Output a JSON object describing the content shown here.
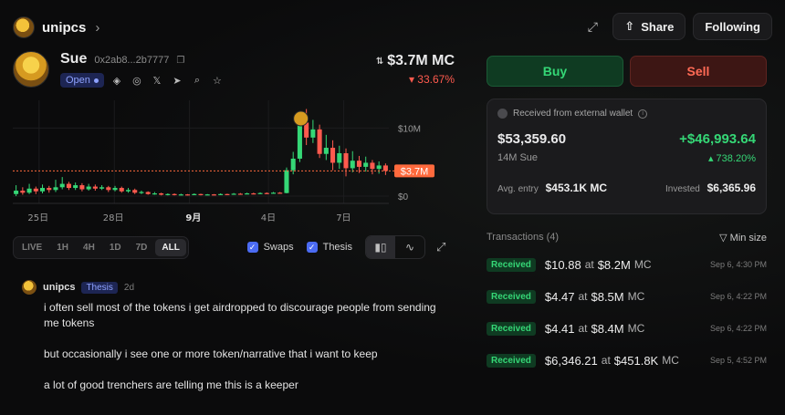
{
  "header": {
    "username": "unipcs",
    "share_label": "Share",
    "following_label": "Following"
  },
  "token": {
    "name": "Sue",
    "address": "0x2ab8...2b7777",
    "status": "Open",
    "market_cap": "$3.7M MC",
    "change": "▾ 33.67%"
  },
  "chart": {
    "price_tag": "$3.7M",
    "y_labels": [
      "$10M",
      "$0"
    ],
    "x_labels": [
      "25日",
      "28日",
      "9月",
      "4日",
      "7日"
    ]
  },
  "chart_data": {
    "type": "candlestick",
    "title": "",
    "xlabel": "",
    "ylabel": "",
    "ylim": [
      0,
      13
    ],
    "y_unit": "$M market cap",
    "x_ticks": [
      "25日",
      "28日",
      "9月",
      "4日",
      "7日"
    ],
    "current_value": 3.7,
    "current_label": "$3.7M",
    "candles": [
      {
        "o": 0.3,
        "c": 0.8,
        "h": 1.6,
        "l": 0.0
      },
      {
        "o": 0.8,
        "c": 0.5,
        "h": 1.3,
        "l": 0.2
      },
      {
        "o": 0.5,
        "c": 1.1,
        "h": 1.8,
        "l": 0.3
      },
      {
        "o": 1.1,
        "c": 0.7,
        "h": 1.4,
        "l": 0.3
      },
      {
        "o": 0.7,
        "c": 1.2,
        "h": 1.7,
        "l": 0.4
      },
      {
        "o": 1.2,
        "c": 0.9,
        "h": 1.5,
        "l": 0.5
      },
      {
        "o": 0.9,
        "c": 1.3,
        "h": 2.4,
        "l": 0.6
      },
      {
        "o": 1.3,
        "c": 1.8,
        "h": 2.8,
        "l": 1.0
      },
      {
        "o": 1.8,
        "c": 1.2,
        "h": 2.1,
        "l": 0.9
      },
      {
        "o": 1.2,
        "c": 1.6,
        "h": 2.0,
        "l": 0.9
      },
      {
        "o": 1.6,
        "c": 1.0,
        "h": 1.9,
        "l": 0.7
      },
      {
        "o": 1.0,
        "c": 1.4,
        "h": 1.8,
        "l": 0.8
      },
      {
        "o": 1.4,
        "c": 1.1,
        "h": 1.7,
        "l": 0.8
      },
      {
        "o": 1.1,
        "c": 1.3,
        "h": 1.6,
        "l": 0.9
      },
      {
        "o": 1.3,
        "c": 0.9,
        "h": 1.5,
        "l": 0.6
      },
      {
        "o": 0.9,
        "c": 1.2,
        "h": 1.5,
        "l": 0.7
      },
      {
        "o": 1.2,
        "c": 0.7,
        "h": 1.4,
        "l": 0.5
      },
      {
        "o": 0.7,
        "c": 0.9,
        "h": 1.2,
        "l": 0.5
      },
      {
        "o": 0.9,
        "c": 0.5,
        "h": 1.1,
        "l": 0.3
      },
      {
        "o": 0.5,
        "c": 0.6,
        "h": 0.8,
        "l": 0.3
      },
      {
        "o": 0.6,
        "c": 0.3,
        "h": 0.7,
        "l": 0.2
      },
      {
        "o": 0.3,
        "c": 0.4,
        "h": 0.6,
        "l": 0.2
      },
      {
        "o": 0.4,
        "c": 0.2,
        "h": 0.5,
        "l": 0.1
      },
      {
        "o": 0.2,
        "c": 0.3,
        "h": 0.4,
        "l": 0.1
      },
      {
        "o": 0.3,
        "c": 0.2,
        "h": 0.4,
        "l": 0.1
      },
      {
        "o": 0.2,
        "c": 0.25,
        "h": 0.35,
        "l": 0.1
      },
      {
        "o": 0.25,
        "c": 0.2,
        "h": 0.3,
        "l": 0.1
      },
      {
        "o": 0.2,
        "c": 0.3,
        "h": 0.4,
        "l": 0.15
      },
      {
        "o": 0.3,
        "c": 0.2,
        "h": 0.35,
        "l": 0.1
      },
      {
        "o": 0.2,
        "c": 0.25,
        "h": 0.3,
        "l": 0.15
      },
      {
        "o": 0.25,
        "c": 0.2,
        "h": 0.3,
        "l": 0.1
      },
      {
        "o": 0.2,
        "c": 0.3,
        "h": 0.4,
        "l": 0.15
      },
      {
        "o": 0.3,
        "c": 0.25,
        "h": 0.35,
        "l": 0.2
      },
      {
        "o": 0.25,
        "c": 0.35,
        "h": 0.45,
        "l": 0.2
      },
      {
        "o": 0.35,
        "c": 0.3,
        "h": 0.45,
        "l": 0.2
      },
      {
        "o": 0.3,
        "c": 0.4,
        "h": 0.5,
        "l": 0.25
      },
      {
        "o": 0.4,
        "c": 0.35,
        "h": 0.5,
        "l": 0.25
      },
      {
        "o": 0.35,
        "c": 0.45,
        "h": 0.55,
        "l": 0.3
      },
      {
        "o": 0.45,
        "c": 0.4,
        "h": 0.55,
        "l": 0.3
      },
      {
        "o": 0.4,
        "c": 0.5,
        "h": 0.6,
        "l": 0.35
      },
      {
        "o": 0.5,
        "c": 0.45,
        "h": 0.6,
        "l": 0.35
      },
      {
        "o": 0.45,
        "c": 3.8,
        "h": 4.2,
        "l": 0.4
      },
      {
        "o": 3.8,
        "c": 5.5,
        "h": 6.5,
        "l": 3.2
      },
      {
        "o": 5.5,
        "c": 10.8,
        "h": 12.0,
        "l": 5.0
      },
      {
        "o": 10.8,
        "c": 8.6,
        "h": 12.8,
        "l": 7.5
      },
      {
        "o": 8.6,
        "c": 9.8,
        "h": 11.2,
        "l": 7.8
      },
      {
        "o": 9.8,
        "c": 6.2,
        "h": 10.5,
        "l": 5.6
      },
      {
        "o": 6.2,
        "c": 7.1,
        "h": 9.0,
        "l": 5.3
      },
      {
        "o": 7.1,
        "c": 4.9,
        "h": 8.2,
        "l": 3.8
      },
      {
        "o": 4.9,
        "c": 6.3,
        "h": 7.4,
        "l": 4.0
      },
      {
        "o": 6.3,
        "c": 4.1,
        "h": 7.0,
        "l": 2.9
      },
      {
        "o": 4.1,
        "c": 5.2,
        "h": 6.6,
        "l": 3.5
      },
      {
        "o": 5.2,
        "c": 4.3,
        "h": 5.9,
        "l": 3.4
      },
      {
        "o": 4.3,
        "c": 4.9,
        "h": 5.8,
        "l": 3.6
      },
      {
        "o": 4.9,
        "c": 4.0,
        "h": 5.3,
        "l": 3.2
      },
      {
        "o": 4.0,
        "c": 4.5,
        "h": 5.1,
        "l": 3.3
      },
      {
        "o": 4.5,
        "c": 3.7,
        "h": 4.8,
        "l": 3.1
      }
    ]
  },
  "controls": {
    "timeframes": [
      "LIVE",
      "1H",
      "4H",
      "1D",
      "7D",
      "ALL"
    ],
    "active_timeframe": "ALL",
    "swaps_label": "Swaps",
    "thesis_label": "Thesis"
  },
  "thesis": {
    "user": "unipcs",
    "badge": "Thesis",
    "time": "2d",
    "paragraphs": [
      "i often sell most of the tokens i get airdropped to discourage people from sending me tokens",
      "but occasionally i see one or more token/narrative that i want to keep",
      "a lot of good trenchers are telling me this is a keeper"
    ]
  },
  "trade": {
    "buy_label": "Buy",
    "sell_label": "Sell"
  },
  "position": {
    "source": "Received from external wallet",
    "value": "$53,359.60",
    "pnl": "+$46,993.64",
    "amount": "14M Sue",
    "pnl_pct": "▴ 738.20%",
    "avg_entry_label": "Avg. entry",
    "avg_entry": "$453.1K MC",
    "invested_label": "Invested",
    "invested": "$6,365.96"
  },
  "transactions": {
    "header": "Transactions (4)",
    "filter": "Min size",
    "items": [
      {
        "type": "Received",
        "amount": "$10.88",
        "mc": "$8.2M",
        "date": "Sep 6, 4:30 PM"
      },
      {
        "type": "Received",
        "amount": "$4.47",
        "mc": "$8.5M",
        "date": "Sep 6, 4:22 PM"
      },
      {
        "type": "Received",
        "amount": "$4.41",
        "mc": "$8.4M",
        "date": "Sep 6, 4:22 PM"
      },
      {
        "type": "Received",
        "amount": "$6,346.21",
        "mc": "$451.8K",
        "date": "Sep 5, 4:52 PM"
      }
    ],
    "at_word": "at",
    "mc_word": "MC"
  },
  "colors": {
    "up": "#35d776",
    "down": "#ff5a4e",
    "accent": "#4b6bf2"
  }
}
